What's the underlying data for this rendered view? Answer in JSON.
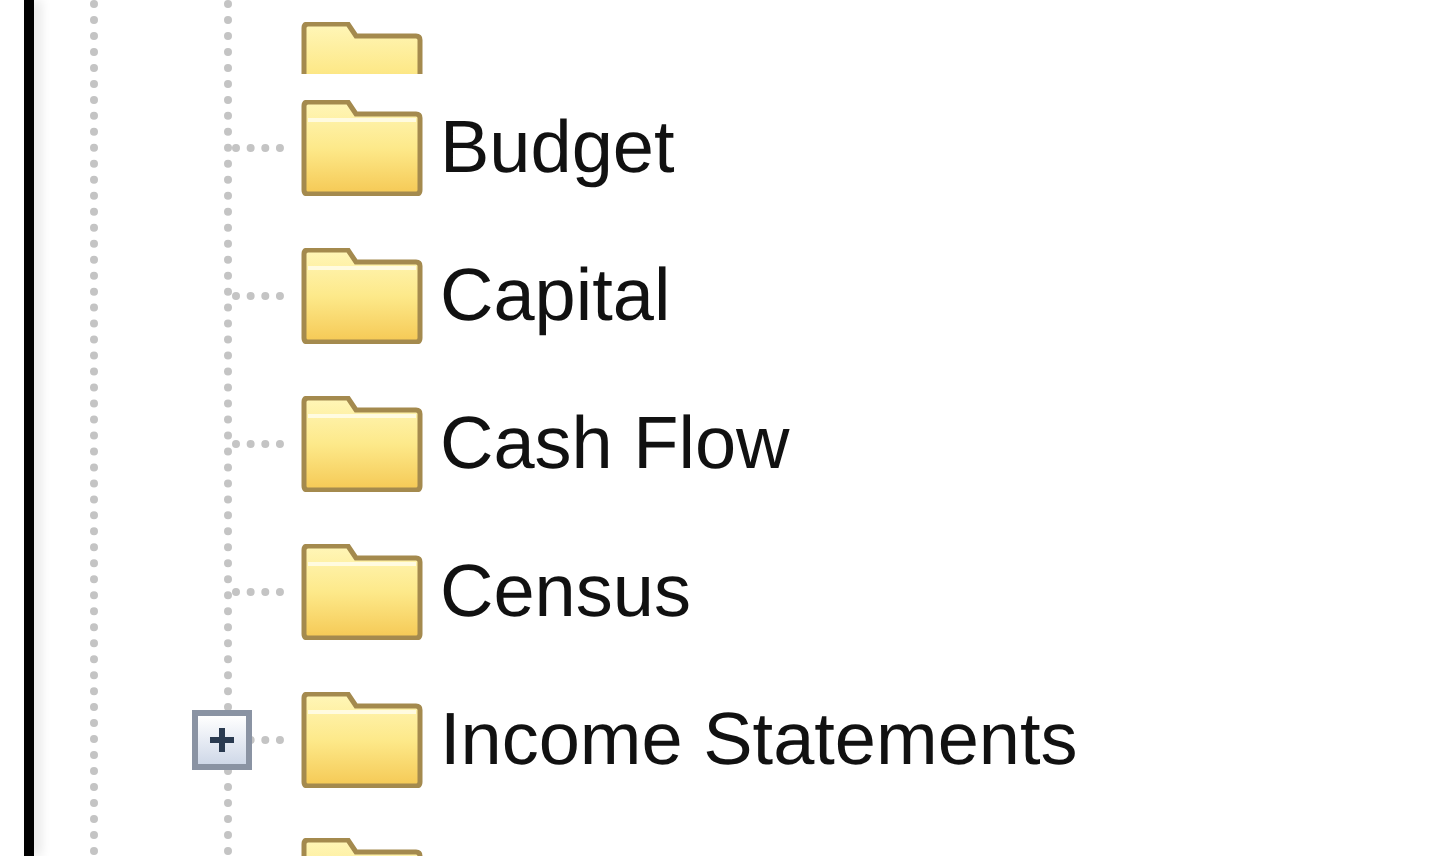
{
  "tree": {
    "items": [
      {
        "label": "Budget",
        "expandable": false
      },
      {
        "label": "Capital",
        "expandable": false
      },
      {
        "label": "Cash Flow",
        "expandable": false
      },
      {
        "label": "Census",
        "expandable": false
      },
      {
        "label": "Income Statements",
        "expandable": true
      }
    ]
  }
}
